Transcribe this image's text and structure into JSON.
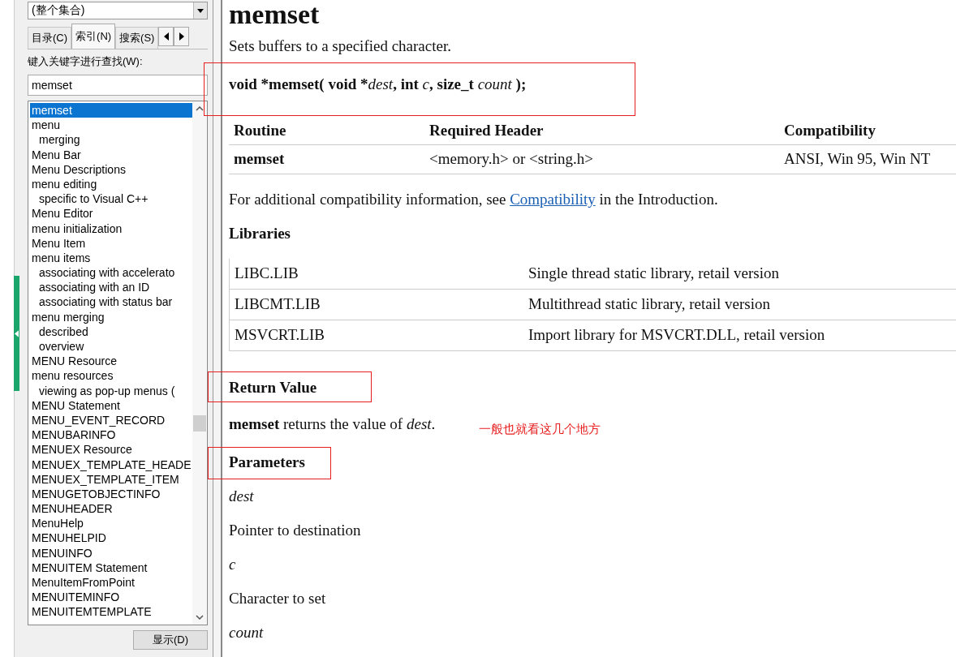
{
  "sidebar": {
    "scope_combo": "(整个集合)",
    "tabs": [
      {
        "label": "目录(C)",
        "selected": false
      },
      {
        "label": "索引(N)",
        "selected": true
      },
      {
        "label": "搜索(S)",
        "selected": false
      }
    ],
    "keyword_label": "键入关键字进行查找(W):",
    "keyword_value": "memset",
    "index_items": [
      {
        "label": "memset",
        "selected": true
      },
      {
        "label": "menu",
        "selected": false,
        "children": [
          {
            "label": "merging",
            "selected": false
          }
        ]
      },
      {
        "label": "Menu Bar",
        "selected": false
      },
      {
        "label": "Menu Descriptions",
        "selected": false
      },
      {
        "label": "menu editing",
        "selected": false,
        "children": [
          {
            "label": "specific to Visual C++",
            "selected": false
          }
        ]
      },
      {
        "label": "Menu Editor",
        "selected": false
      },
      {
        "label": "menu initialization",
        "selected": false
      },
      {
        "label": "Menu Item",
        "selected": false
      },
      {
        "label": "menu items",
        "selected": false,
        "children": [
          {
            "label": "associating with accelerato",
            "selected": false
          },
          {
            "label": "associating with an ID",
            "selected": false
          },
          {
            "label": "associating with status bar",
            "selected": false
          }
        ]
      },
      {
        "label": "menu merging",
        "selected": false,
        "children": [
          {
            "label": "described",
            "selected": false
          },
          {
            "label": "overview",
            "selected": false
          }
        ]
      },
      {
        "label": "MENU Resource",
        "selected": false
      },
      {
        "label": "menu resources",
        "selected": false,
        "children": [
          {
            "label": "viewing as pop-up menus (",
            "selected": false
          }
        ]
      },
      {
        "label": "MENU Statement",
        "selected": false
      },
      {
        "label": "MENU_EVENT_RECORD",
        "selected": false
      },
      {
        "label": "MENUBARINFO",
        "selected": false
      },
      {
        "label": "MENUEX Resource",
        "selected": false
      },
      {
        "label": "MENUEX_TEMPLATE_HEADE",
        "selected": false
      },
      {
        "label": "MENUEX_TEMPLATE_ITEM",
        "selected": false
      },
      {
        "label": "MENUGETOBJECTINFO",
        "selected": false
      },
      {
        "label": "MENUHEADER",
        "selected": false
      },
      {
        "label": "MenuHelp",
        "selected": false
      },
      {
        "label": "MENUHELPID",
        "selected": false
      },
      {
        "label": "MENUINFO",
        "selected": false
      },
      {
        "label": "MENUITEM Statement",
        "selected": false
      },
      {
        "label": "MenuItemFromPoint",
        "selected": false
      },
      {
        "label": "MENUITEMINFO",
        "selected": false
      },
      {
        "label": "MENUITEMTEMPLATE",
        "selected": false
      }
    ],
    "display_button": "显示(D)"
  },
  "article": {
    "title": "memset",
    "summary": "Sets buffers to a specified character.",
    "signature": {
      "highlighted": true,
      "parts": [
        {
          "text": "void *memset( void *",
          "kind": "bold"
        },
        {
          "text": "dest",
          "kind": "italic"
        },
        {
          "text": ", int ",
          "kind": "bold"
        },
        {
          "text": "c",
          "kind": "italic"
        },
        {
          "text": ", size_t ",
          "kind": "bold"
        },
        {
          "text": "count",
          "kind": "italic"
        },
        {
          "text": " );",
          "kind": "bold"
        }
      ]
    },
    "routine_table": {
      "columns": [
        "Routine",
        "Required Header",
        "Compatibility"
      ],
      "rows": [
        [
          "memset",
          "<memory.h> or <string.h>",
          "ANSI, Win 95, Win NT"
        ]
      ]
    },
    "compat_note": {
      "before": "For additional compatibility information, see ",
      "link": "Compatibility",
      "after": " in the Introduction."
    },
    "libraries_heading": "Libraries",
    "libraries": [
      [
        "LIBC.LIB",
        "Single thread static library, retail version"
      ],
      [
        "LIBCMT.LIB",
        "Multithread static library, retail version"
      ],
      [
        "MSVCRT.LIB",
        "Import library for MSVCRT.DLL, retail version"
      ]
    ],
    "return_heading": {
      "text": "Return Value",
      "highlighted": true
    },
    "return_text": "**memset** returns the value of *dest*.",
    "parameters_heading": {
      "text": "Parameters",
      "highlighted": true
    },
    "parameters": [
      {
        "name": "dest",
        "description": "Pointer to destination"
      },
      {
        "name": "c",
        "description": "Character to set"
      },
      {
        "name": "count"
      }
    ]
  },
  "annotation_note": "一般也就看这几个地方"
}
